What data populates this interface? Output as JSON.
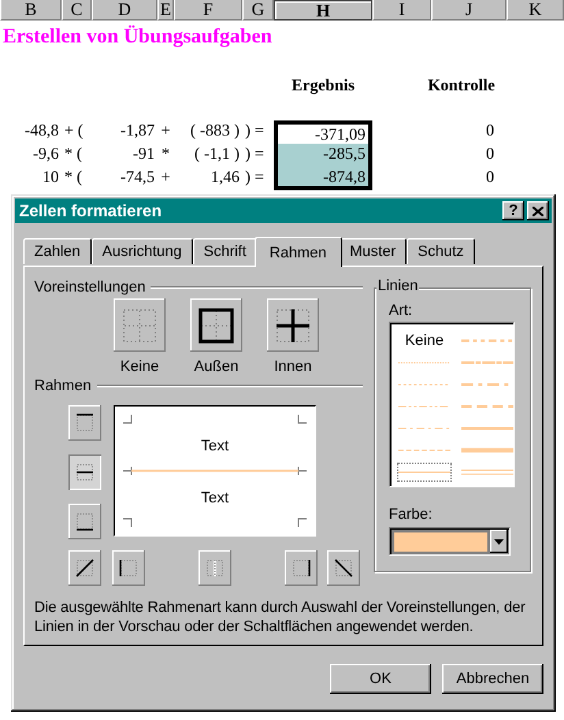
{
  "sheet": {
    "columns": [
      {
        "label": "B",
        "selected": false
      },
      {
        "label": "C",
        "selected": false
      },
      {
        "label": "D",
        "selected": false
      },
      {
        "label": "E",
        "selected": false
      },
      {
        "label": "F",
        "selected": false
      },
      {
        "label": "G",
        "selected": false
      },
      {
        "label": "H",
        "selected": true
      },
      {
        "label": "I",
        "selected": false
      },
      {
        "label": "J",
        "selected": false
      },
      {
        "label": "K",
        "selected": false
      }
    ],
    "title": "Erstellen von Übungsaufgaben",
    "headers": {
      "result": "Ergebnis",
      "check": "Kontrolle"
    },
    "rows": [
      {
        "cells": [
          "-48,8",
          "+ (",
          "-1,87",
          "+",
          "( -883 )",
          ") ="
        ],
        "result": "-371,09",
        "active": true,
        "check": "0"
      },
      {
        "cells": [
          "-9,6",
          "* (",
          "-91",
          "*",
          "( -1,1 )",
          ") ="
        ],
        "result": "-285,5",
        "active": false,
        "check": "0"
      },
      {
        "cells": [
          "10",
          "* (",
          "-74,5",
          "+",
          "1,46",
          ") ="
        ],
        "result": "-874,8",
        "active": false,
        "check": "0"
      }
    ]
  },
  "dialog": {
    "title": "Zellen formatieren",
    "help": "?",
    "tabs": [
      {
        "label": "Zahlen",
        "selected": false
      },
      {
        "label": "Ausrichtung",
        "selected": false
      },
      {
        "label": "Schrift",
        "selected": false
      },
      {
        "label": "Rahmen",
        "selected": true
      },
      {
        "label": "Muster",
        "selected": false
      },
      {
        "label": "Schutz",
        "selected": false
      }
    ],
    "presets_label": "Voreinstellungen",
    "presets": [
      {
        "kind": "none",
        "label": "Keine"
      },
      {
        "kind": "outline",
        "label": "Außen"
      },
      {
        "kind": "inside",
        "label": "Innen"
      }
    ],
    "border_label": "Rahmen",
    "border_buttons": [
      {
        "kind": "top",
        "pressed": false
      },
      {
        "kind": "middle-h",
        "pressed": true
      },
      {
        "kind": "bottom",
        "pressed": false
      },
      {
        "kind": "diag-up",
        "pressed": false
      },
      {
        "kind": "left",
        "pressed": false
      },
      {
        "kind": "middle-v",
        "pressed": false
      },
      {
        "kind": "right",
        "pressed": false
      },
      {
        "kind": "diag-down",
        "pressed": false
      }
    ],
    "preview": {
      "texts": [
        "Text",
        "Text"
      ]
    },
    "lines_label": "Linien",
    "style_label": "Art:",
    "styles": [
      {
        "kind": "none",
        "label": "Keine",
        "selected": false
      },
      {
        "kind": "medium-dash-dot-dot",
        "selected": false
      },
      {
        "kind": "hair",
        "selected": false
      },
      {
        "kind": "slanted",
        "selected": false
      },
      {
        "kind": "dotted",
        "selected": false
      },
      {
        "kind": "medium-dash-dot",
        "selected": false
      },
      {
        "kind": "dash-dot-dot",
        "selected": false
      },
      {
        "kind": "medium-dashed",
        "selected": false
      },
      {
        "kind": "dash-dot",
        "selected": false
      },
      {
        "kind": "medium",
        "selected": false
      },
      {
        "kind": "dashed",
        "selected": false
      },
      {
        "kind": "thick",
        "selected": false
      },
      {
        "kind": "thin",
        "selected": true
      },
      {
        "kind": "double",
        "selected": false
      }
    ],
    "color_label": "Farbe:",
    "color": "#ffcc99",
    "description": "Die ausgewählte Rahmenart kann durch Auswahl der Voreinstellungen, der Linien in der Vorschau oder der Schaltflächen angewendet werden.",
    "buttons": [
      "OK",
      "Abbrechen"
    ]
  }
}
